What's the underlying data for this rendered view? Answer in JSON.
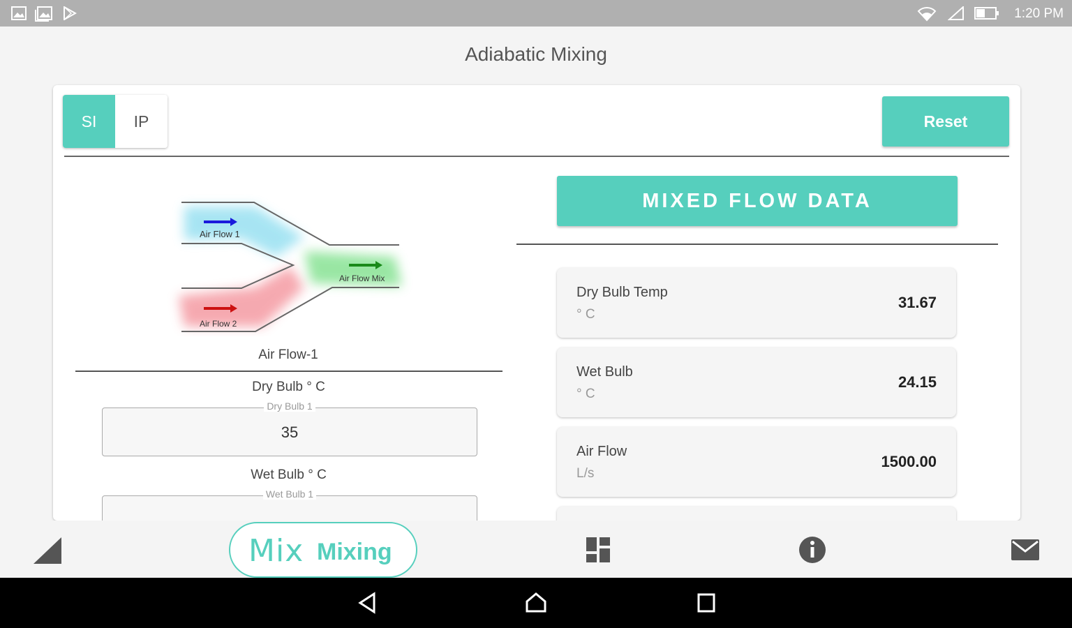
{
  "status_bar": {
    "time": "1:20 PM",
    "left_icons": [
      "image-icon",
      "gallery-icon",
      "play-store-icon"
    ],
    "right_icons": [
      "wifi-icon",
      "signal-icon",
      "battery-icon"
    ]
  },
  "app": {
    "title": "Adiabatic Mixing"
  },
  "units": {
    "options": [
      "SI",
      "IP"
    ],
    "selected": "SI"
  },
  "reset_label": "Reset",
  "inputs": {
    "flow_title": "Air Flow-1",
    "dry_bulb": {
      "label": "Dry Bulb ° C",
      "placeholder": "Dry Bulb 1",
      "value": "35"
    },
    "wet_bulb": {
      "label": "Wet Bulb ° C",
      "placeholder": "Wet Bulb 1",
      "value": ""
    }
  },
  "diagram": {
    "labels": {
      "flow1": "Air Flow 1",
      "flow2": "Air Flow 2",
      "mix": "Air Flow Mix"
    }
  },
  "results": {
    "header": "MIXED FLOW DATA",
    "items": [
      {
        "label": "Dry Bulb Temp",
        "unit": "° C",
        "value": "31.67"
      },
      {
        "label": "Wet Bulb",
        "unit": "° C",
        "value": "24.15"
      },
      {
        "label": "Air Flow",
        "unit": "L/s",
        "value": "1500.00"
      }
    ]
  },
  "bottom_nav": {
    "mix_logo": "Mix",
    "mix_label": "Mixing",
    "icons": [
      "chart-icon",
      "mixing-icon",
      "dashboard-icon",
      "info-icon",
      "mail-icon"
    ]
  },
  "colors": {
    "accent": "#56cfbd",
    "status_bar": "#b0b0b0",
    "flow1": "#1a1adc",
    "flow2": "#cc1111",
    "mix": "#1a8a1a"
  }
}
